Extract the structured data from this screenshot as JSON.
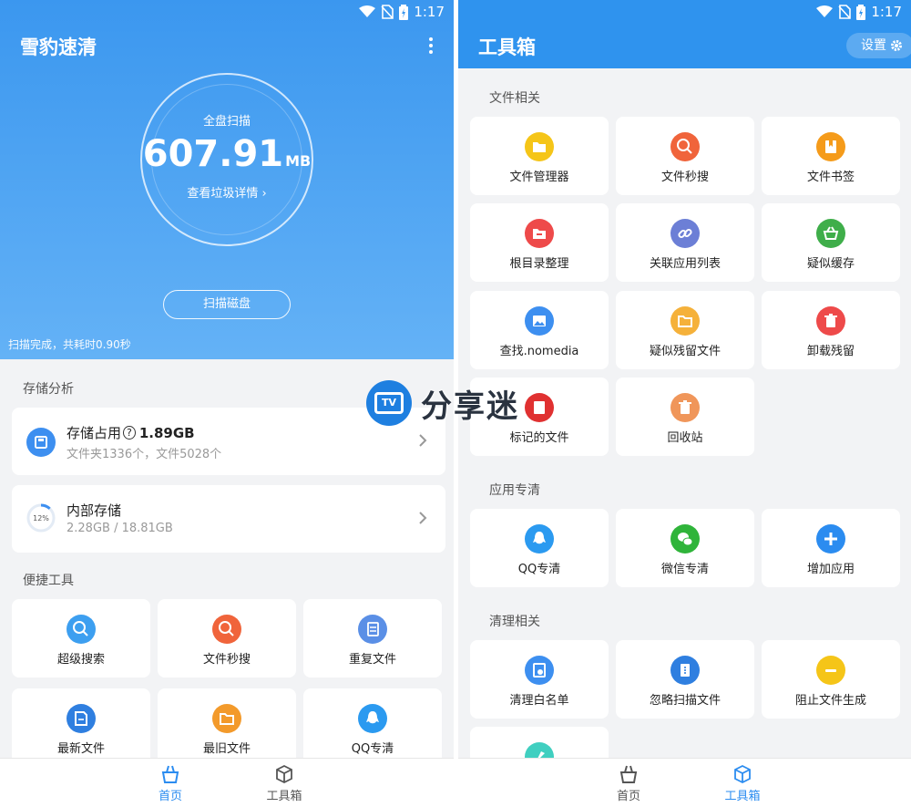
{
  "status": {
    "time": "1:17"
  },
  "home": {
    "title": "雪豹速清",
    "scan_label": "全盘扫描",
    "size_value": "607.91",
    "size_unit": "MB",
    "detail_link": "查看垃圾详情 ›",
    "scan_button": "扫描磁盘",
    "scan_status": "扫描完成，共耗时0.90秒",
    "storage_section": "存储分析",
    "storage_used": {
      "title": "存储占用",
      "help_icon": "?",
      "value": "1.89GB",
      "sub": "文件夹1336个，文件5028个",
      "icon": "sd-card-icon",
      "color": "#3d8ff0"
    },
    "internal_storage": {
      "title": "内部存储",
      "sub": "2.28GB / 18.81GB",
      "percent_label": "12%",
      "percent": 12
    },
    "tools_section": "便捷工具",
    "tools": [
      {
        "label": "超级搜索",
        "icon": "search-icon",
        "color": "#3d9ff0"
      },
      {
        "label": "文件秒搜",
        "icon": "file-search-icon",
        "color": "#f0643b"
      },
      {
        "label": "重复文件",
        "icon": "duplicate-file-icon",
        "color": "#5a8fe6"
      },
      {
        "label": "最新文件",
        "icon": "new-file-icon",
        "color": "#2f7fe0"
      },
      {
        "label": "最旧文件",
        "icon": "old-file-icon",
        "color": "#f39a2b"
      },
      {
        "label": "QQ专清",
        "icon": "qq-icon",
        "color": "#2b9af0"
      }
    ]
  },
  "toolbox": {
    "title": "工具箱",
    "settings": "设置",
    "file_section": "文件相关",
    "file_tools": [
      {
        "label": "文件管理器",
        "icon": "folder-icon",
        "color": "#f5c518"
      },
      {
        "label": "文件秒搜",
        "icon": "file-search-icon",
        "color": "#f0643b"
      },
      {
        "label": "文件书签",
        "icon": "bookmark-icon",
        "color": "#f59b1a"
      },
      {
        "label": "根目录整理",
        "icon": "root-folder-icon",
        "color": "#ee4a4a"
      },
      {
        "label": "关联应用列表",
        "icon": "link-icon",
        "color": "#6c7fd6"
      },
      {
        "label": "疑似缓存",
        "icon": "basket-icon",
        "color": "#3fae4a"
      },
      {
        "label": "查找.nomedia",
        "icon": "image-icon",
        "color": "#3d8ff0"
      },
      {
        "label": "疑似残留文件",
        "icon": "residual-folder-icon",
        "color": "#f5b13a"
      },
      {
        "label": "卸载残留",
        "icon": "trash-icon",
        "color": "#ee4a4a"
      },
      {
        "label": "标记的文件",
        "icon": "marked-file-icon",
        "color": "#e03131"
      },
      {
        "label": "回收站",
        "icon": "recycle-bin-icon",
        "color": "#f0965a"
      }
    ],
    "app_section": "应用专清",
    "app_tools": [
      {
        "label": "QQ专清",
        "icon": "qq-icon",
        "color": "#2b9af0"
      },
      {
        "label": "微信专清",
        "icon": "wechat-icon",
        "color": "#2fb43a"
      },
      {
        "label": "增加应用",
        "icon": "plus-icon",
        "color": "#2b8cf0"
      }
    ],
    "clean_section": "清理相关",
    "clean_tools": [
      {
        "label": "清理白名单",
        "icon": "whitelist-icon",
        "color": "#3d8ff0"
      },
      {
        "label": "忽略扫描文件",
        "icon": "ignore-file-icon",
        "color": "#2f7fe0"
      },
      {
        "label": "阻止文件生成",
        "icon": "block-icon",
        "color": "#f5c518"
      },
      {
        "label": "",
        "icon": "rocket-icon",
        "color": "#40cfc0"
      }
    ]
  },
  "nav": {
    "home": "首页",
    "toolbox": "工具箱"
  },
  "watermark": {
    "badge": "TV",
    "text": "分享迷"
  }
}
